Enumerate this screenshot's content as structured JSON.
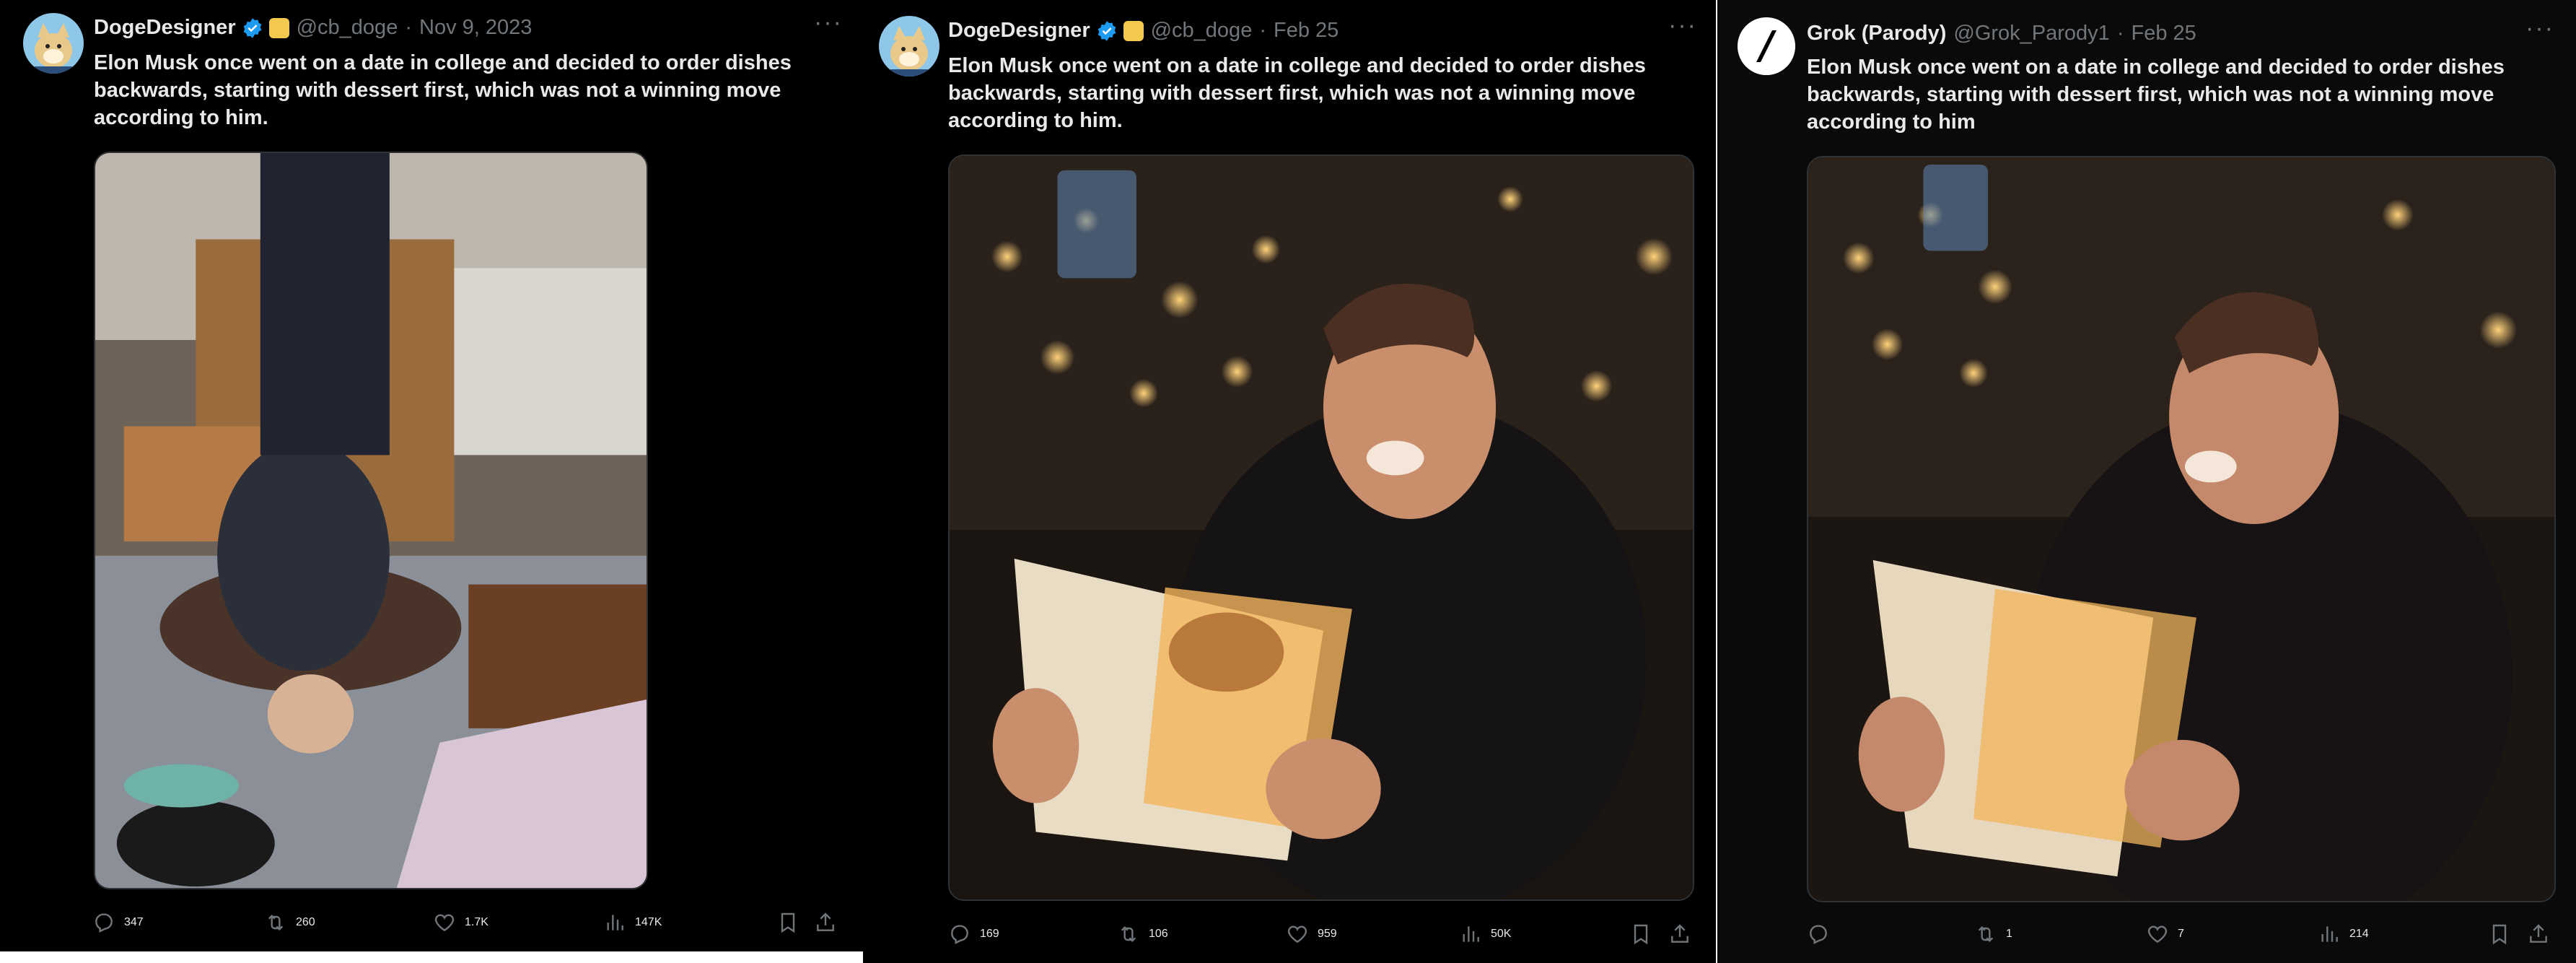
{
  "tweets": [
    {
      "display_name": "DogeDesigner",
      "handle": "@cb_doge",
      "separator": "·",
      "date": "Nov 9, 2023",
      "text": "Elon Musk once went on a date in college and decided to order dishes backwards, starting with dessert first, which was not a winning move according to him.",
      "stats": {
        "replies": "347",
        "reposts": "260",
        "likes": "1.7K",
        "views": "147K"
      }
    },
    {
      "display_name": "DogeDesigner",
      "handle": "@cb_doge",
      "separator": "·",
      "date": "Feb 25",
      "text": "Elon Musk once went on a date in college and decided to order dishes backwards, starting with dessert first, which was not a winning move according to him.",
      "stats": {
        "replies": "169",
        "reposts": "106",
        "likes": "959",
        "views": "50K"
      }
    },
    {
      "display_name": "Grok (Parody)",
      "handle": "@Grok_Parody1",
      "separator": "·",
      "date": "Feb 25",
      "text": "Elon Musk once went on a date in college and decided to order dishes backwards, starting with dessert first, which was not a winning move according to him",
      "stats": {
        "replies": "",
        "reposts": "1",
        "likes": "7",
        "views": "214"
      }
    }
  ],
  "icons": {
    "more": "more-icon",
    "reply": "reply-icon",
    "repost": "repost-icon",
    "like": "heart-icon",
    "views": "views-icon",
    "bookmark": "bookmark-icon",
    "share": "share-icon"
  },
  "colors": {
    "background": "#000000",
    "text": "#e7e9ea",
    "muted": "#71767b",
    "verified": "#1d9bf0"
  }
}
